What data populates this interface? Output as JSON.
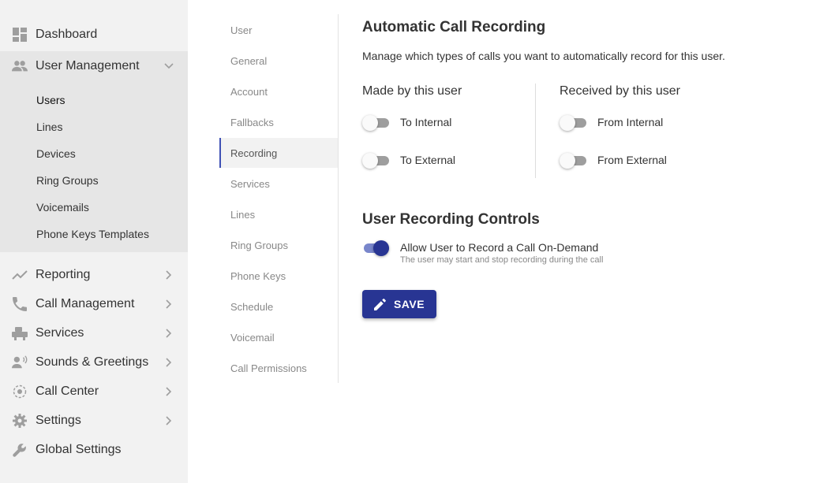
{
  "sidebar": {
    "dashboard": {
      "label": "Dashboard",
      "icon": "dashboard-icon"
    },
    "user_management": {
      "label": "User Management",
      "icon": "people-icon",
      "items": [
        {
          "label": "Users"
        },
        {
          "label": "Lines"
        },
        {
          "label": "Devices"
        },
        {
          "label": "Ring Groups"
        },
        {
          "label": "Voicemails"
        },
        {
          "label": "Phone Keys Templates"
        }
      ],
      "active_item": "Users"
    },
    "reporting": {
      "label": "Reporting",
      "icon": "trending-icon"
    },
    "call_management": {
      "label": "Call Management",
      "icon": "phone-icon"
    },
    "services": {
      "label": "Services",
      "icon": "services-icon"
    },
    "sounds_greetings": {
      "label": "Sounds & Greetings",
      "icon": "record-voice-icon"
    },
    "call_center": {
      "label": "Call Center",
      "icon": "call-center-icon"
    },
    "settings": {
      "label": "Settings",
      "icon": "gear-icon"
    },
    "global_settings": {
      "label": "Global Settings",
      "icon": "wrench-icon"
    }
  },
  "settings_menu": {
    "items": [
      {
        "label": "User"
      },
      {
        "label": "General"
      },
      {
        "label": "Account"
      },
      {
        "label": "Fallbacks"
      },
      {
        "label": "Recording"
      },
      {
        "label": "Services"
      },
      {
        "label": "Lines"
      },
      {
        "label": "Ring Groups"
      },
      {
        "label": "Phone Keys"
      },
      {
        "label": "Schedule"
      },
      {
        "label": "Voicemail"
      },
      {
        "label": "Call Permissions"
      }
    ],
    "active": "Recording"
  },
  "content": {
    "title": "Automatic Call Recording",
    "description": "Manage which types of calls you want to automatically record for this user.",
    "made_by": {
      "heading": "Made by this user",
      "toggles": [
        {
          "label": "To Internal",
          "on": false
        },
        {
          "label": "To External",
          "on": false
        }
      ]
    },
    "received_by": {
      "heading": "Received by this user",
      "toggles": [
        {
          "label": "From Internal",
          "on": false
        },
        {
          "label": "From External",
          "on": false
        }
      ]
    },
    "controls": {
      "title": "User Recording Controls",
      "toggle_label": "Allow User to Record a Call On-Demand",
      "toggle_on": true,
      "hint": "The user may start and stop recording during the call"
    },
    "save_label": "SAVE"
  },
  "colors": {
    "accent": "#283593",
    "toggle_track_on": "#7986cb",
    "sidebar_bg": "#f2f2f2",
    "submenu_bg": "#e6e6e6"
  }
}
